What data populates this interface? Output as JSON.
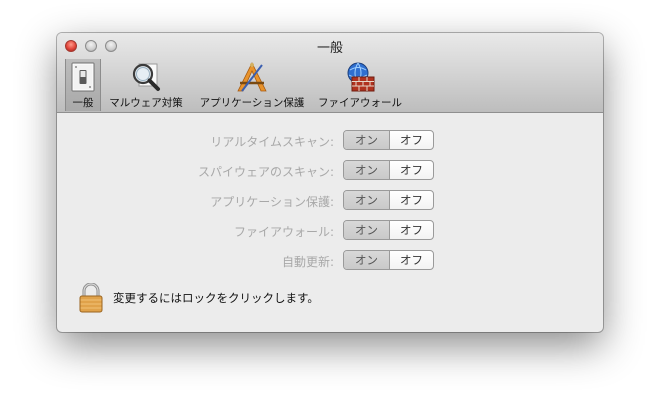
{
  "window": {
    "title": "一般"
  },
  "tabs": [
    {
      "label": "一般",
      "icon": "switch-icon",
      "selected": true
    },
    {
      "label": "マルウェア対策",
      "icon": "magnifier-icon",
      "selected": false
    },
    {
      "label": "アプリケーション保護",
      "icon": "app-protection-icon",
      "selected": false
    },
    {
      "label": "ファイアウォール",
      "icon": "firewall-icon",
      "selected": false
    }
  ],
  "settings": [
    {
      "label": "リアルタイムスキャン:",
      "on": "オン",
      "off": "オフ"
    },
    {
      "label": "スパイウェアのスキャン:",
      "on": "オン",
      "off": "オフ"
    },
    {
      "label": "アプリケーション保護:",
      "on": "オン",
      "off": "オフ"
    },
    {
      "label": "ファイアウォール:",
      "on": "オン",
      "off": "オフ"
    },
    {
      "label": "自動更新:",
      "on": "オン",
      "off": "オフ"
    }
  ],
  "lock": {
    "text": "変更するにはロックをクリックします。",
    "icon": "padlock-icon"
  },
  "colors": {
    "disabled_label": "#a8a8a8",
    "close_button": "#e2463b"
  }
}
